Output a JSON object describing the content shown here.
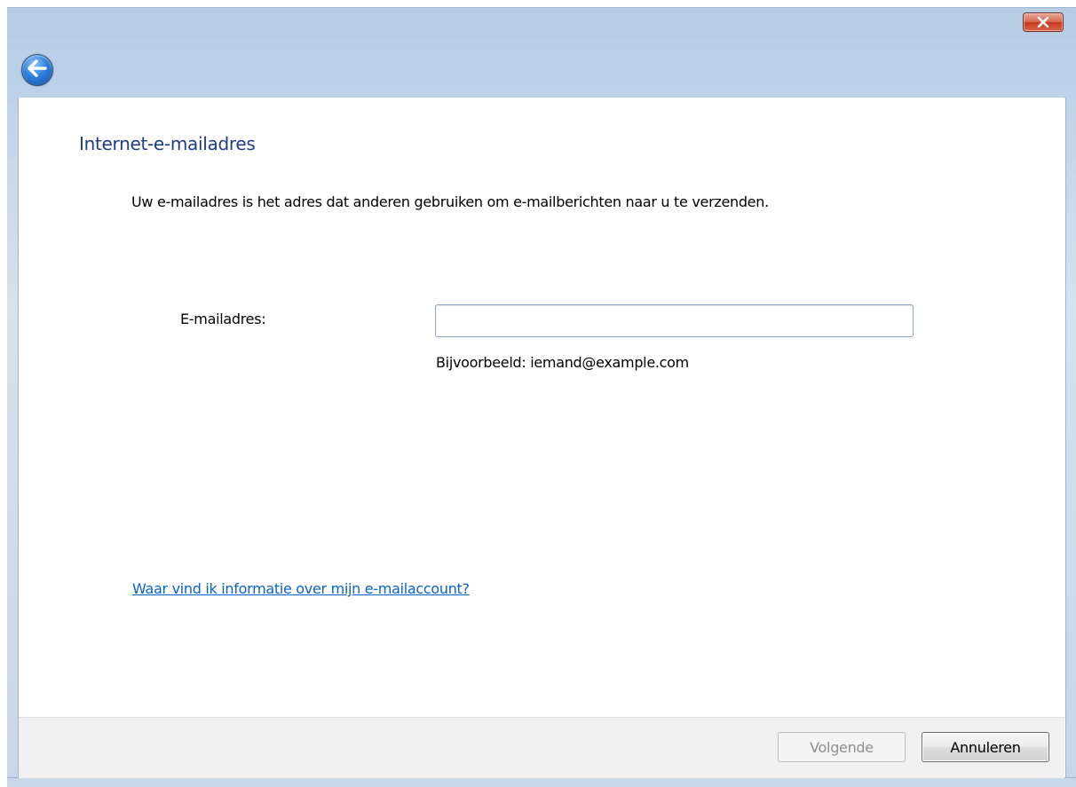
{
  "window": {
    "close_icon": "close-icon",
    "back_icon": "back-arrow-icon"
  },
  "page": {
    "title": "Internet-e-mailadres",
    "intro": "Uw e-mailadres is het adres dat anderen gebruiken om e-mailberichten naar u te verzenden.",
    "email_label": "E-mailadres:",
    "email_value": "",
    "example": "Bijvoorbeeld: iemand@example.com",
    "help_link": "Waar vind ik informatie over mijn e-mailaccount?"
  },
  "footer": {
    "next_label": "Volgende",
    "next_enabled": false,
    "cancel_label": "Annuleren"
  },
  "colors": {
    "title_blue": "#1f3d83",
    "link_blue": "#0a62c9",
    "close_red": "#c7381f"
  }
}
